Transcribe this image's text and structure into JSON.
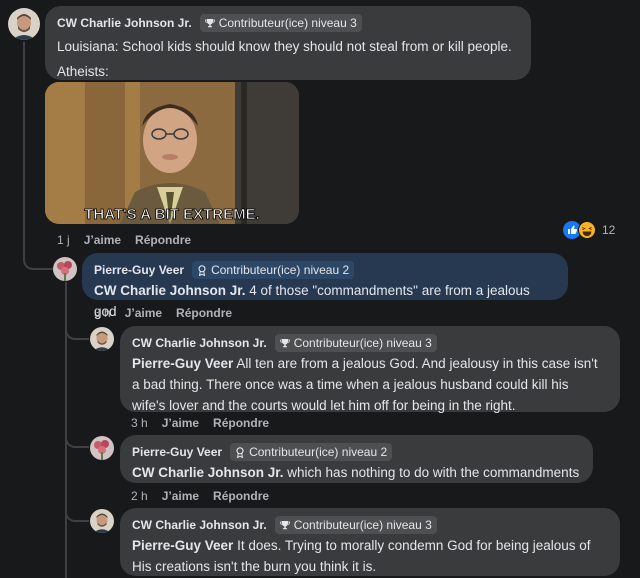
{
  "comments": [
    {
      "author": "CW Charlie Johnson Jr.",
      "badge": "Contributeur(ice) niveau 3",
      "line1": "Louisiana: School kids should know they should not steal from or kill people.",
      "line2": "Atheists:",
      "gif_caption": "THAT'S A BIT EXTREME.",
      "time": "1 j",
      "like": "J’aime",
      "reply": "Répondre",
      "reaction_count": "12"
    },
    {
      "author": "Pierre-Guy Veer",
      "badge": "Contributeur(ice) niveau 2",
      "mention": "CW Charlie Johnson Jr.",
      "text": " 4 of those \"commandments\" are from a jealous god",
      "time": "3 h",
      "like": "J’aime",
      "reply": "Répondre"
    },
    {
      "author": "CW Charlie Johnson Jr.",
      "badge": "Contributeur(ice) niveau 3",
      "mention": "Pierre-Guy Veer",
      "text_l1": " All ten are from a jealous God. And jealousy in this case isn't",
      "text_l2": "a bad thing. There once was a time when a jealous husband could kill his",
      "text_l3": "wife's lover and the courts would let him off for being in the right.",
      "time": "3 h",
      "like": "J’aime",
      "reply": "Répondre"
    },
    {
      "author": "Pierre-Guy Veer",
      "badge": "Contributeur(ice) niveau 2",
      "mention": "CW Charlie Johnson Jr.",
      "text": " which has nothing to do with the commandments",
      "time": "2 h",
      "like": "J’aime",
      "reply": "Répondre"
    },
    {
      "author": "CW Charlie Johnson Jr.",
      "badge": "Contributeur(ice) niveau 3",
      "mention": "Pierre-Guy Veer",
      "text_l1": " It does. Trying to morally condemn God for being jealous of",
      "text_l2": "His creations isn't the burn you think it is."
    }
  ],
  "colors": {
    "background": "#18191a",
    "bubble": "#3a3b3c",
    "highlight_bubble": "#263951",
    "secondary_text": "#b0b3b8"
  }
}
